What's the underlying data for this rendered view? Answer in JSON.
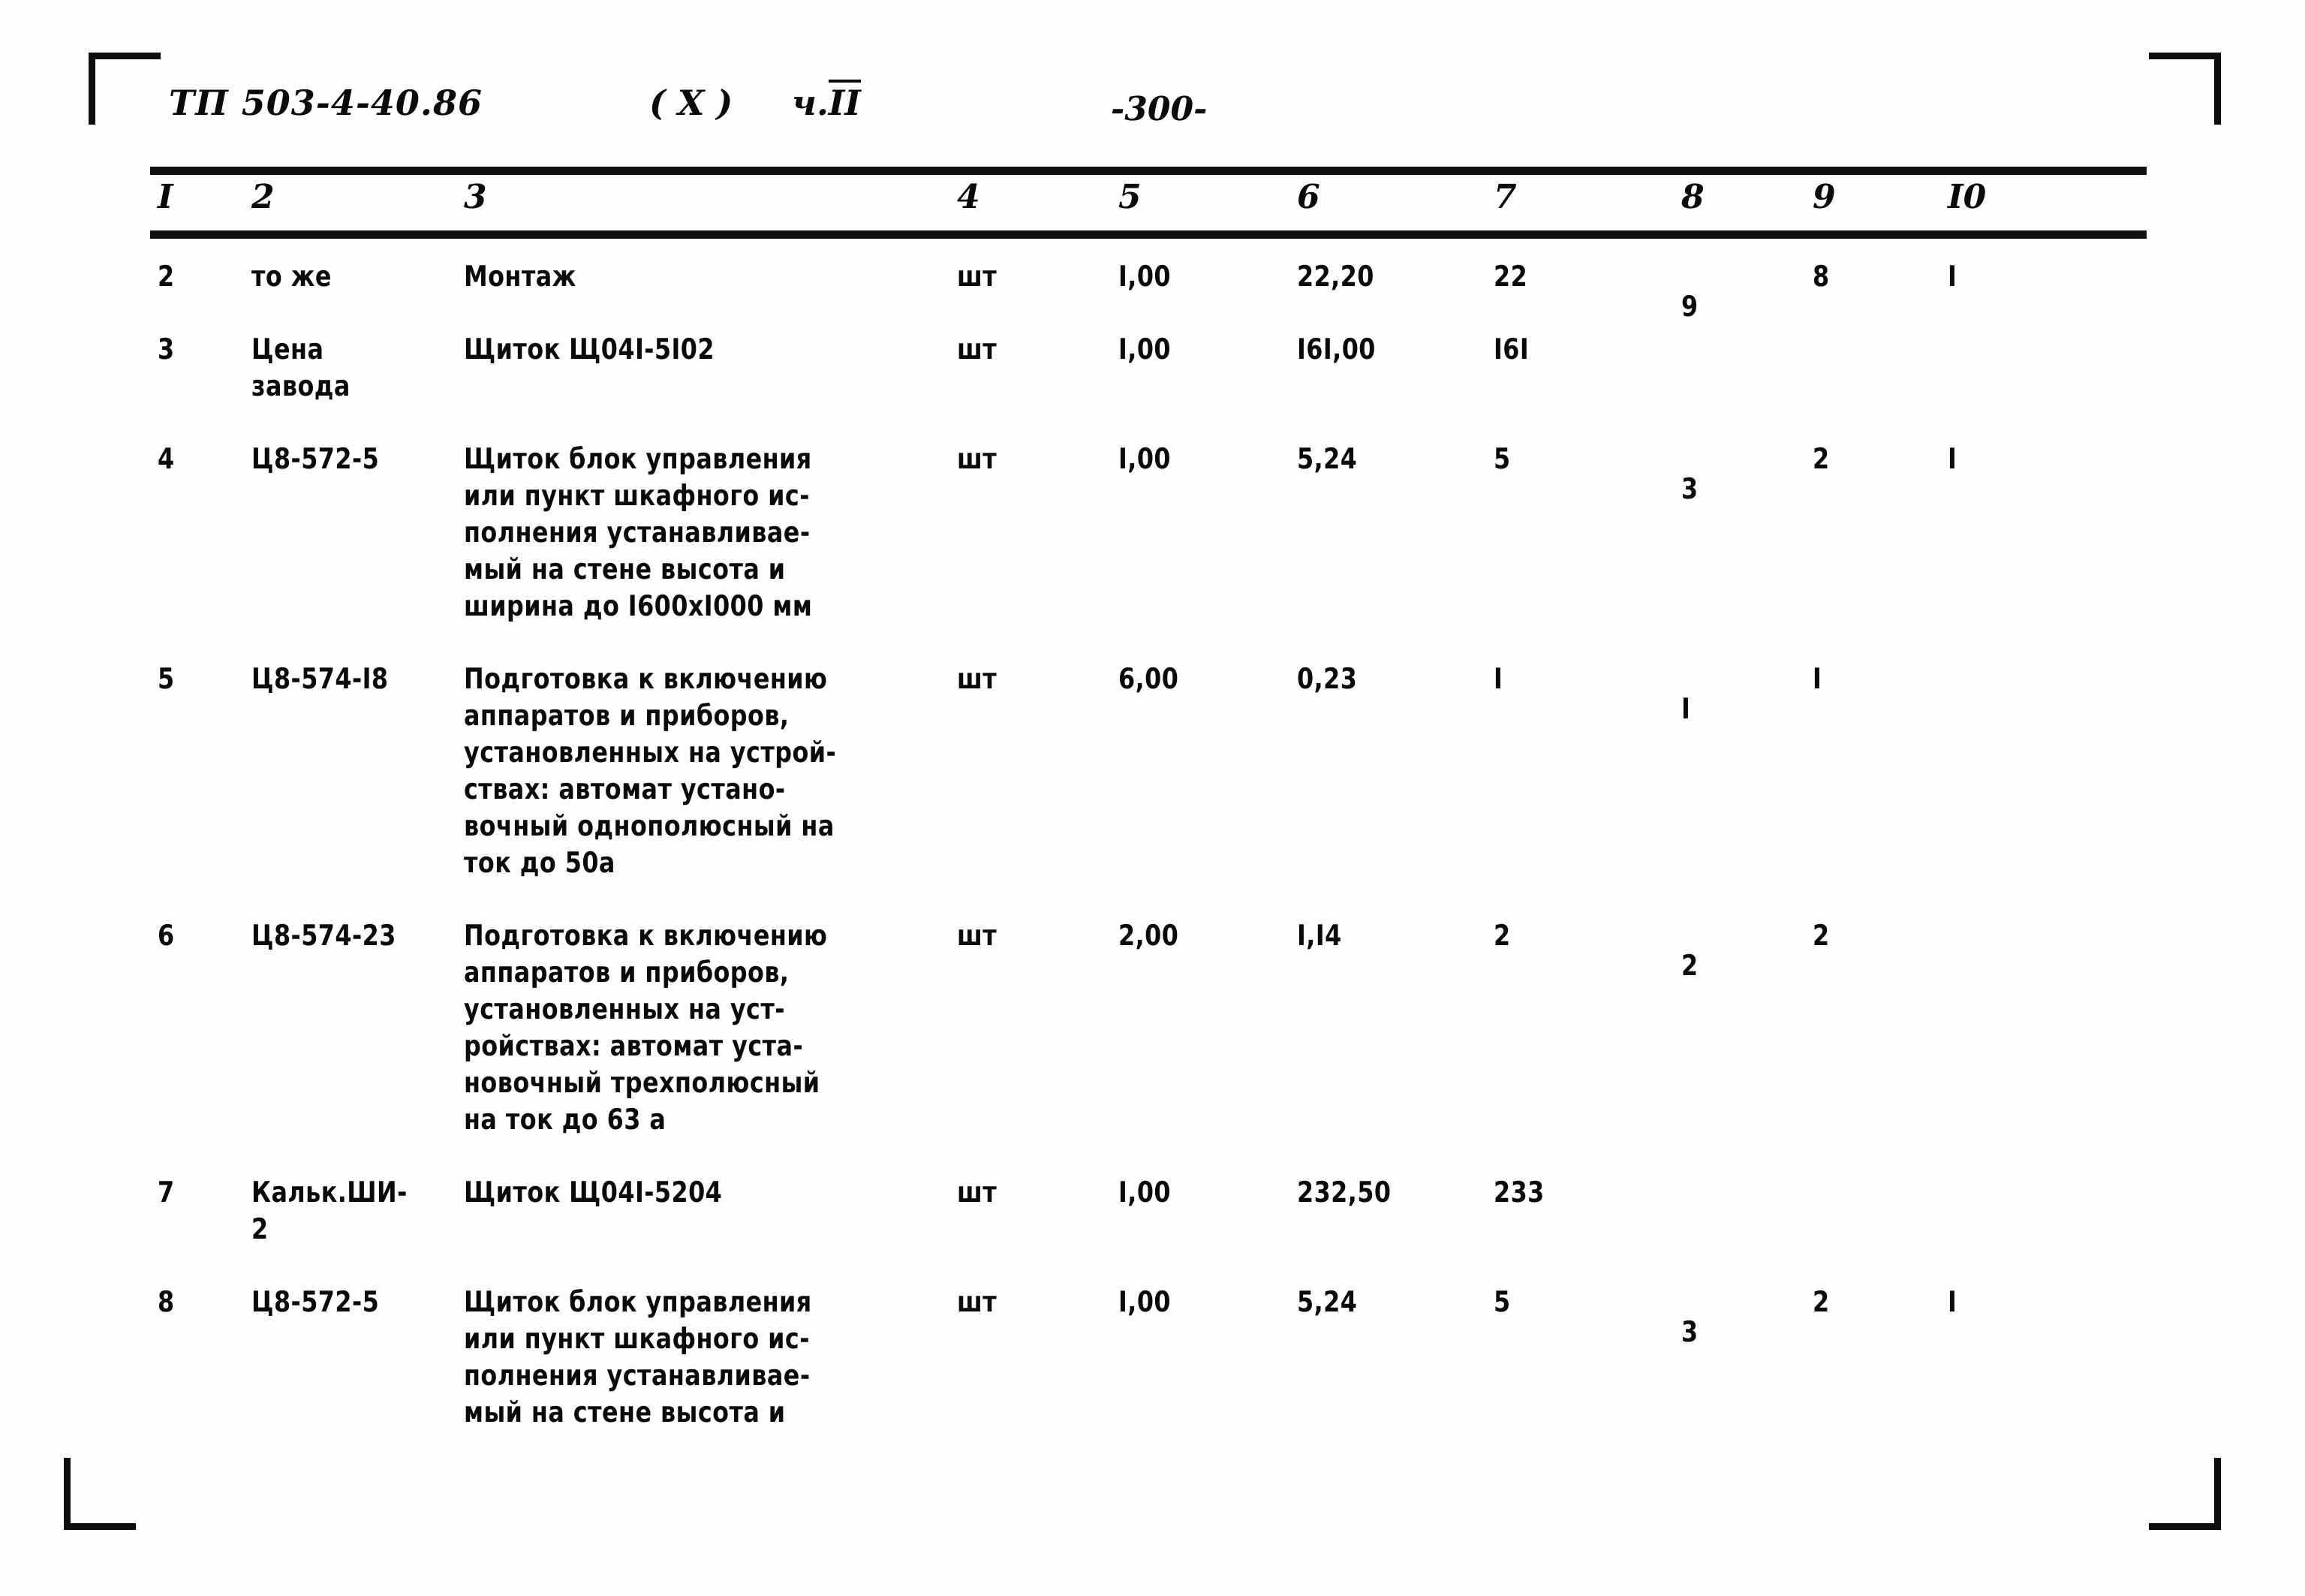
{
  "document": {
    "code": "ТП 503-4-40.86",
    "variant": "( X )",
    "part_prefix": "ч.",
    "part": "II",
    "page_number": "-300-"
  },
  "table": {
    "column_numbers": [
      "I",
      "2",
      "3",
      "4",
      "5",
      "6",
      "7",
      "8",
      "9",
      "I0"
    ],
    "rows": [
      {
        "c1": "2",
        "c2": "то же",
        "c3": "Монтаж",
        "c4": "шт",
        "c5": "I,00",
        "c6": "22,20",
        "c7": "22",
        "c8": "9",
        "c9": "8",
        "c10": "I"
      },
      {
        "c1": "3",
        "c2": "Цена\nзавода",
        "c3": "Щиток Щ04I-5I02",
        "c4": "шт",
        "c5": "I,00",
        "c6": "I6I,00",
        "c7": "I6I",
        "c8": "",
        "c9": "",
        "c10": ""
      },
      {
        "c1": "4",
        "c2": "Ц8-572-5",
        "c3": "Щиток блок управления\nили пункт шкафного ис-\nполнения устанавливае-\nмый на стене высота и\nширина до I600хI000 мм",
        "c4": "шт",
        "c5": "I,00",
        "c6": "5,24",
        "c7": "5",
        "c8": "3",
        "c9": "2",
        "c10": "I"
      },
      {
        "c1": "5",
        "c2": "Ц8-574-I8",
        "c3": "Подготовка к включению\nаппаратов и приборов,\nустановленных на устрой-\nствах: автомат устано-\nвочный однополюсный на\nток до 50а",
        "c4": "шт",
        "c5": "6,00",
        "c6": "0,23",
        "c7": "I",
        "c8": "I",
        "c9": "I",
        "c10": ""
      },
      {
        "c1": "6",
        "c2": "Ц8-574-23",
        "c3": "Подготовка к включению\nаппаратов и приборов,\nустановленных на уст-\nройствах: автомат уста-\nновочный трехполюсный\nна ток до 63 а",
        "c4": "шт",
        "c5": "2,00",
        "c6": "I,I4",
        "c7": "2",
        "c8": "2",
        "c9": "2",
        "c10": ""
      },
      {
        "c1": "7",
        "c2": "Кальк.ШИ-\n2",
        "c3": "Щиток Щ04I-5204",
        "c4": "шт",
        "c5": "I,00",
        "c6": "232,50",
        "c7": "233",
        "c8": "",
        "c9": "",
        "c10": ""
      },
      {
        "c1": "8",
        "c2": "Ц8-572-5",
        "c3": "Щиток блок управления\nили пункт шкафного ис-\nполнения устанавливае-\nмый на стене высота и",
        "c4": "шт",
        "c5": "I,00",
        "c6": "5,24",
        "c7": "5",
        "c8": "3",
        "c9": "2",
        "c10": "I"
      }
    ]
  }
}
